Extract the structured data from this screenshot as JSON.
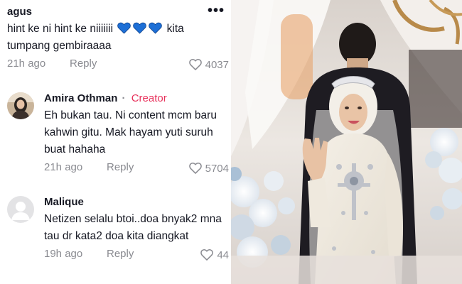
{
  "comments": [
    {
      "username": "agus",
      "text_1": "hint ke ni hint ke niiiiiii",
      "text_2": "kita",
      "text_3": "tumpang gembiraaaa",
      "time": "21h ago",
      "reply": "Reply",
      "likes": "4037",
      "more": "•••"
    },
    {
      "username": "Amira Othman",
      "separator": "·",
      "badge": "Creator",
      "text": "Eh bukan tau. Ni content mcm baru kahwin gitu. Mak hayam yuti suruh buat hahaha",
      "time": "21h ago",
      "reply": "Reply",
      "likes": "5704"
    },
    {
      "username": "Malique",
      "text": "Netizen selalu btoi..doa bnyak2 mna tau dr kata2 doa kita diangkat",
      "time": "19h ago",
      "reply": "Reply",
      "likes": "44"
    }
  ],
  "icons": {
    "more": "more-dots-icon",
    "heart": "heart-outline-icon",
    "emoji": "blue-heart-emoji"
  },
  "colors": {
    "creator": "#e8325c",
    "meta": "#8a8b91",
    "blue_heart": "#1d6fd6"
  }
}
